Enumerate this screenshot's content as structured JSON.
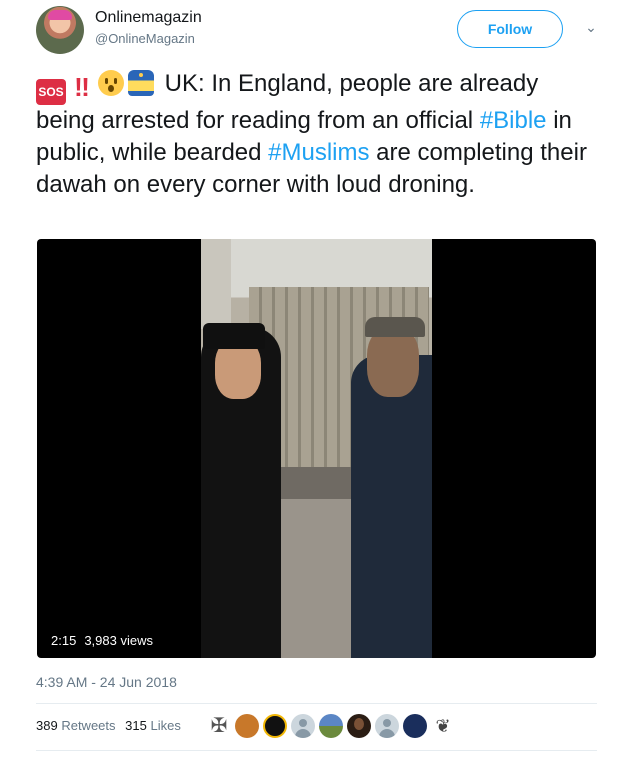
{
  "author": {
    "display_name": "Onlinemagazin",
    "handle": "@OnlineMagazin",
    "avatar_icon": "user-avatar"
  },
  "follow_button": {
    "label": "Follow",
    "color": "#1da1f2"
  },
  "menu_caret": {
    "icon": "chevron-down-icon",
    "glyph": "⌄"
  },
  "tweet": {
    "emojis": [
      "sos-icon",
      "double-exclamation-icon",
      "hushed-face-icon",
      "police-officer-icon"
    ],
    "emoji_sos_text": "SOS",
    "emoji_bang_text": "‼",
    "text_part1": "UK: In England, people are already being arrested for reading from an official ",
    "hashtag1": "#Bible",
    "text_part2": " in public, while bearded ",
    "hashtag2": "#Muslims",
    "text_part3": " are completing their dawah on every corner with loud droning.",
    "hashtag_color": "#1da1f2"
  },
  "video": {
    "duration": "2:15",
    "views": "3,983 views"
  },
  "timestamp": "4:39 AM - 24 Jun 2018",
  "stats": {
    "retweets_count": "389",
    "retweets_label": "Retweets",
    "likes_count": "315",
    "likes_label": "Likes"
  },
  "likers": [
    {
      "icon": "cross-avatar"
    },
    {
      "icon": "liker-avatar"
    },
    {
      "icon": "liker-avatar"
    },
    {
      "icon": "default-avatar"
    },
    {
      "icon": "liker-avatar"
    },
    {
      "icon": "liker-avatar"
    },
    {
      "icon": "default-avatar"
    },
    {
      "icon": "liker-avatar"
    },
    {
      "icon": "liker-avatar"
    }
  ]
}
